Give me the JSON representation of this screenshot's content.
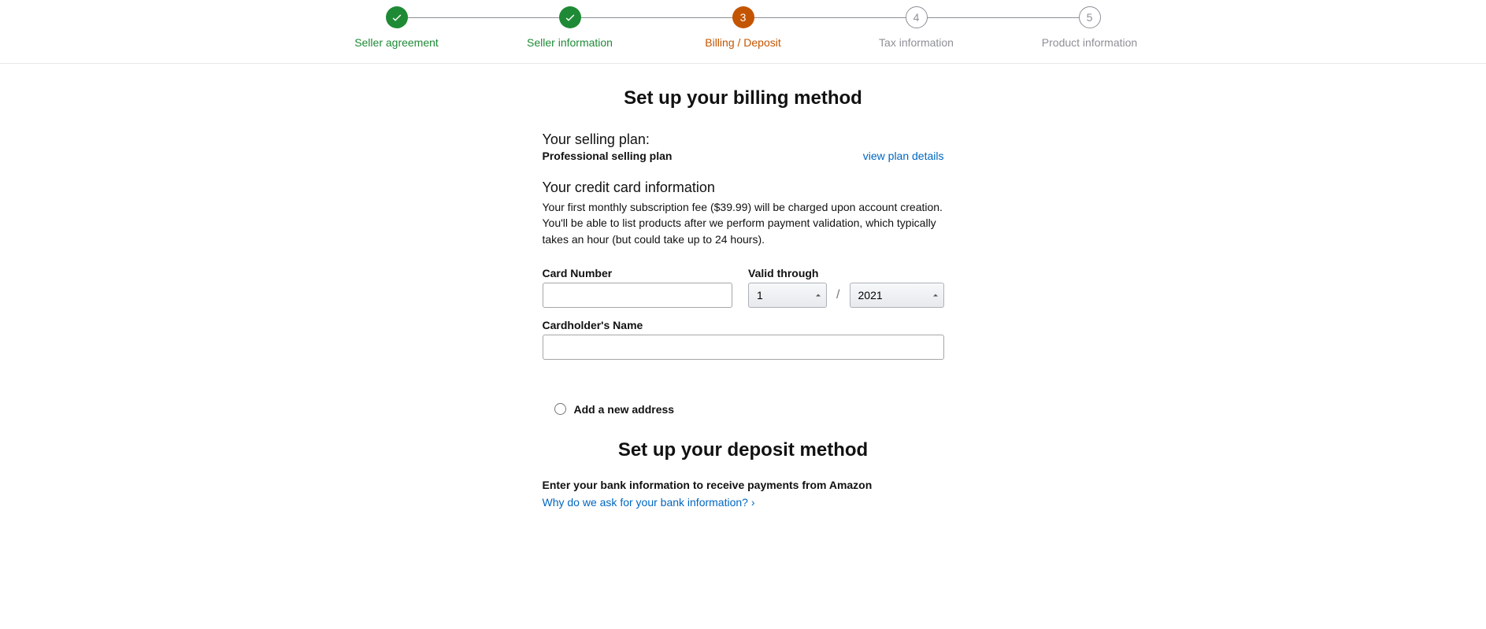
{
  "stepper": {
    "steps": [
      {
        "label": "Seller agreement",
        "state": "done"
      },
      {
        "label": "Seller information",
        "state": "done"
      },
      {
        "label": "Billing / Deposit",
        "state": "active",
        "number": "3"
      },
      {
        "label": "Tax information",
        "state": "pending",
        "number": "4"
      },
      {
        "label": "Product information",
        "state": "pending",
        "number": "5"
      }
    ]
  },
  "billing": {
    "title": "Set up your billing method",
    "plan_label": "Your selling plan:",
    "plan_name": "Professional selling plan",
    "plan_link": "view plan details",
    "cc_heading": "Your credit card information",
    "cc_desc": "Your first monthly subscription fee ($39.99) will be charged upon account creation. You'll be able to list products after we perform payment validation, which typically takes an hour (but could take up to 24 hours).",
    "card_number_label": "Card Number",
    "card_number_value": "",
    "valid_label": "Valid through",
    "month": "1",
    "year": "2021",
    "cardholder_label": "Cardholder's Name",
    "cardholder_value": "",
    "add_address": "Add a new address"
  },
  "deposit": {
    "title": "Set up your deposit method",
    "sub": "Enter your bank information to receive payments from Amazon",
    "link": "Why do we ask for your bank information?"
  }
}
